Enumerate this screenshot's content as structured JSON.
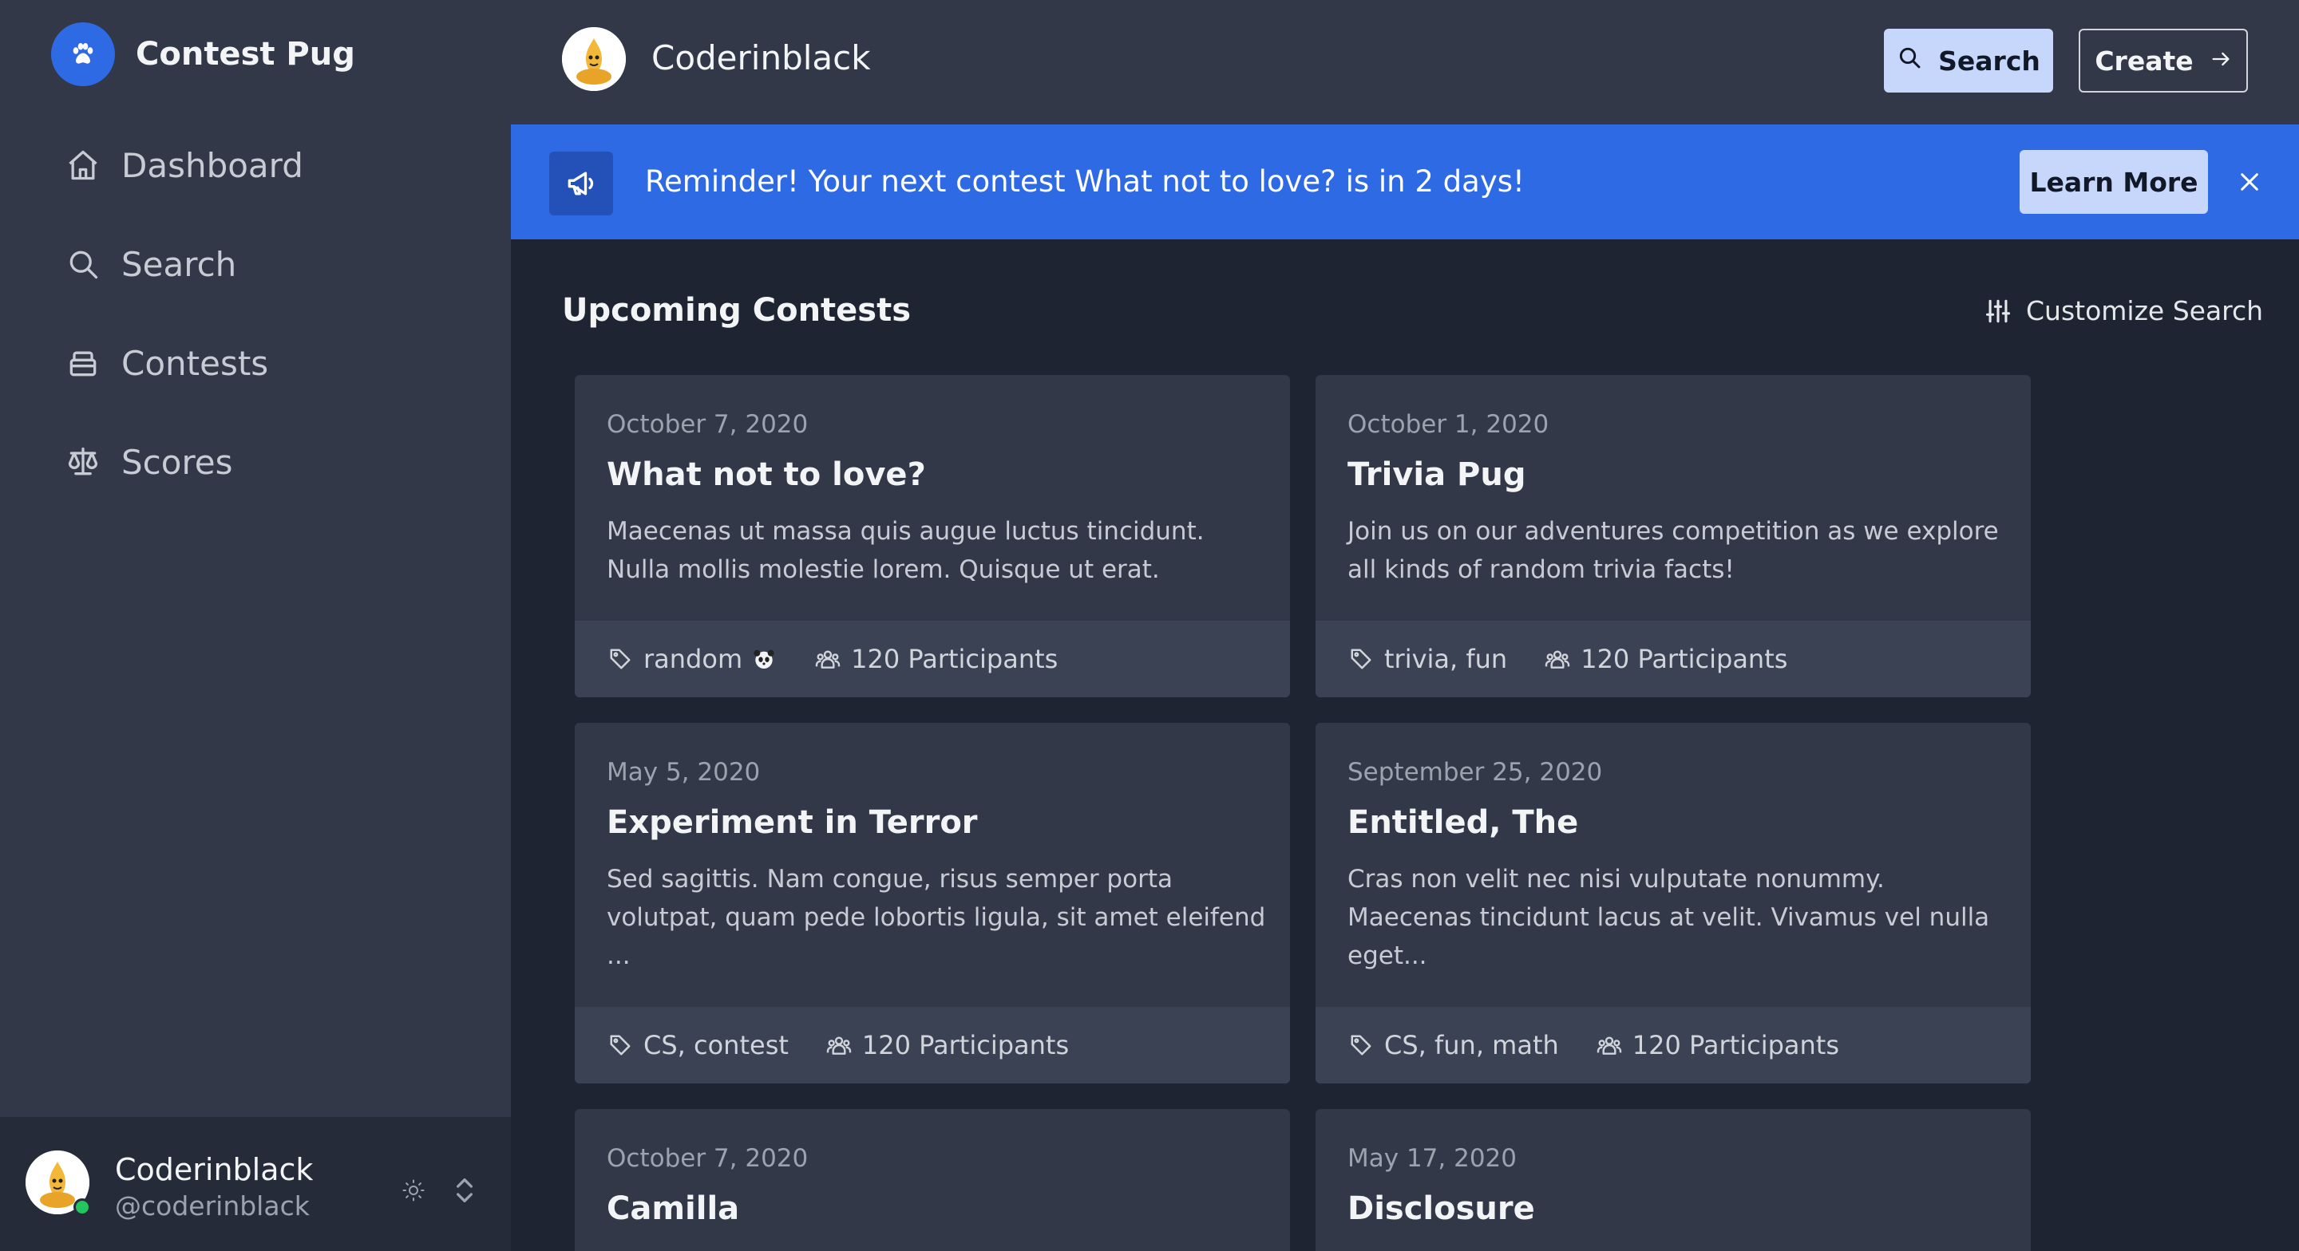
{
  "app": {
    "name": "Contest Pug",
    "accent": "#2f6ae5"
  },
  "sidebar": {
    "items": [
      {
        "label": "Dashboard",
        "icon": "home-icon"
      },
      {
        "label": "Search",
        "icon": "search-icon"
      },
      {
        "label": "Contests",
        "icon": "box-icon"
      },
      {
        "label": "Scores",
        "icon": "scale-icon"
      }
    ],
    "user": {
      "name": "Coderinblack",
      "handle": "@coderinblack",
      "status": "online"
    }
  },
  "header": {
    "user_name": "Coderinblack",
    "search_label": "Search",
    "create_label": "Create"
  },
  "banner": {
    "text": "Reminder! Your next contest What not to love? is in 2 days!",
    "button_label": "Learn More"
  },
  "main": {
    "section_title": "Upcoming Contests",
    "customize_label": "Customize Search",
    "cards": [
      {
        "date": "October 7, 2020",
        "title": "What not to love?",
        "description": "Maecenas ut massa quis augue luctus tincidunt. Nulla mollis molestie lorem. Quisque ut erat.",
        "tags": "random",
        "participants": "120 Participants"
      },
      {
        "date": "October 1, 2020",
        "title": "Trivia Pug",
        "description": "Join us on our adventures competition as we explore all kinds of random trivia facts!",
        "tags": "trivia, fun",
        "participants": "120 Participants"
      },
      {
        "date": "May 5, 2020",
        "title": "Experiment in Terror",
        "description": "Sed sagittis. Nam congue, risus semper porta volutpat, quam pede lobortis ligula, sit amet eleifend ...",
        "tags": "CS, contest",
        "participants": "120 Participants"
      },
      {
        "date": "September 25, 2020",
        "title": "Entitled, The",
        "description": "Cras non velit nec nisi vulputate nonummy. Maecenas tincidunt lacus at velit. Vivamus vel nulla eget...",
        "tags": "CS, fun, math",
        "participants": "120 Participants"
      },
      {
        "date": "October 7, 2020",
        "title": "Camilla"
      },
      {
        "date": "May 17, 2020",
        "title": "Disclosure"
      }
    ]
  }
}
